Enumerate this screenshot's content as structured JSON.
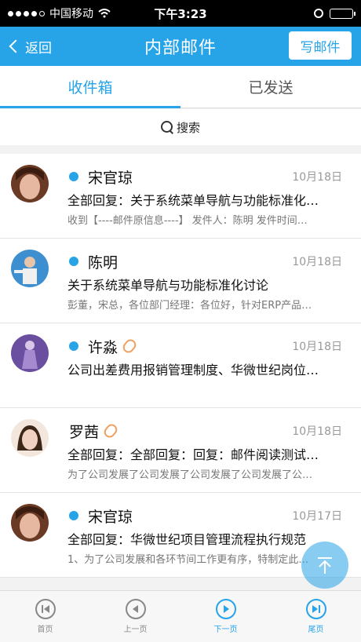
{
  "status_bar": {
    "carrier": "中国移动",
    "time": "下午3:23"
  },
  "header": {
    "back_label": "返回",
    "title": "内部邮件",
    "compose_label": "写邮件"
  },
  "tabs": [
    {
      "label": "收件箱",
      "active": true
    },
    {
      "label": "已发送",
      "active": false
    }
  ],
  "search": {
    "label": "搜索"
  },
  "mails": [
    {
      "sender": "宋官琼",
      "unread": true,
      "attachment": false,
      "date": "10月18日",
      "subject": "全部回复：关于系统菜单导航与功能标准化…",
      "preview": "收到【----邮件原信息----】 发件人：陈明 发件时间…",
      "avatar_color": "#c97c63"
    },
    {
      "sender": "陈明",
      "unread": true,
      "attachment": false,
      "date": "10月18日",
      "subject": "关于系统菜单导航与功能标准化讨论",
      "preview": "彭董，宋总，各位部门经理：各位好，针对ERP产品…",
      "avatar_color": "#2a7fbf"
    },
    {
      "sender": "许淼",
      "unread": true,
      "attachment": true,
      "date": "10月18日",
      "subject": "公司出差费用报销管理制度、华微世纪岗位…",
      "preview": "",
      "avatar_color": "#7a5aa8"
    },
    {
      "sender": "罗茜",
      "unread": false,
      "attachment": true,
      "date": "10月18日",
      "subject": "全部回复：全部回复：回复：邮件阅读测试…",
      "preview": "为了公司发展了公司发展了公司发展了公司发展了公…",
      "avatar_color": "#b98a74"
    },
    {
      "sender": "宋官琼",
      "unread": true,
      "attachment": false,
      "date": "10月17日",
      "subject": "全部回复：华微世纪项目管理流程执行规范",
      "preview": "1、为了公司发展和各环节间工作更有序，特制定此…",
      "avatar_color": "#c97c63"
    }
  ],
  "bottom_nav": [
    {
      "label": "首页",
      "icon": "first-page-icon",
      "active": false
    },
    {
      "label": "上一页",
      "icon": "previous-page-icon",
      "active": false
    },
    {
      "label": "下一页",
      "icon": "next-page-icon",
      "active": true
    },
    {
      "label": "尾页",
      "icon": "last-page-icon",
      "active": true
    }
  ],
  "colors": {
    "accent": "#27a3e8",
    "attachment": "#f0a060"
  }
}
